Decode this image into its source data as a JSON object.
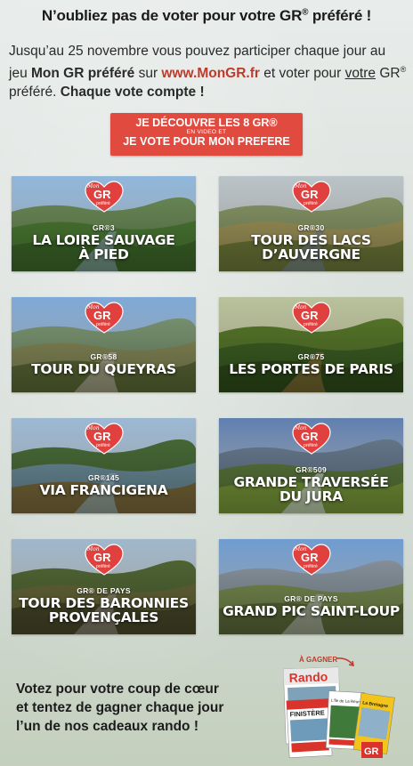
{
  "header": {
    "title_main": "N’oubliez pas de voter pour votre GR",
    "title_sup": "®",
    "title_end": " préféré !"
  },
  "intro": {
    "t1": "Jusqu’au 25 novembre vous pouvez participer chaque jour au jeu ",
    "t2": "Mon GR préféré",
    "t3": " sur ",
    "link": "www.MonGR.fr",
    "t4": " et voter pour ",
    "t5": "votre",
    "t6": " GR",
    "t6_sup": "®",
    "t7": " préféré. ",
    "t8": "Chaque vote compte !"
  },
  "cta": {
    "line1": "JE DÉCOUVRE LES 8 GR®",
    "line2": "EN VIDEO ET",
    "line3": "JE VOTE POUR MON PREFERE"
  },
  "badge": {
    "mon": "Mon",
    "gr": "GR",
    "prefere": "préféré"
  },
  "trails": [
    {
      "num": "GR®3",
      "name1": "LA LOIRE SAUVAGE",
      "name2": "À PIED"
    },
    {
      "num": "GR®30",
      "name1": "TOUR DES LACS",
      "name2": "D’AUVERGNE"
    },
    {
      "num": "GR®58",
      "name1": "TOUR DU QUEYRAS",
      "name2": ""
    },
    {
      "num": "GR®75",
      "name1": "LES PORTES DE PARIS",
      "name2": ""
    },
    {
      "num": "GR®145",
      "name1": "VIA FRANCIGENA",
      "name2": ""
    },
    {
      "num": "GR®509",
      "name1": "GRANDE TRAVERSÉE",
      "name2": "DU JURA"
    },
    {
      "num": "GR® DE PAYS",
      "name1": "TOUR DES BARONNIES",
      "name2": "PROVENÇALES"
    },
    {
      "num": "GR® DE PAYS",
      "name1": "GRAND PIC SAINT-LOUP",
      "name2": ""
    }
  ],
  "footer": {
    "line1": "Votez pour votre coup de cœur",
    "line2": "et tentez de gagner chaque jour",
    "line3": "l’un de nos cadeaux rando !",
    "gagner": "À GAGNER",
    "mag1": "Rando",
    "mag2": "FINISTÈRE",
    "mag3": "L'Île de La Réunion",
    "mag4": "La Bretagne",
    "mag5": "GR"
  }
}
